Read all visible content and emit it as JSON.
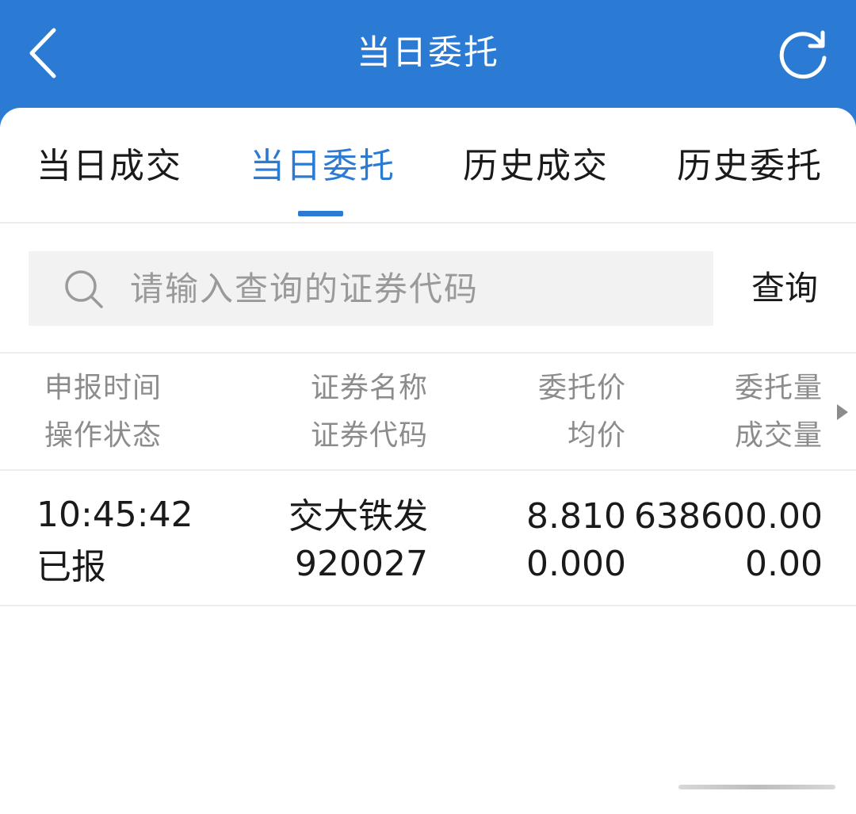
{
  "header": {
    "title": "当日委托",
    "back_icon": "chevron-left-icon",
    "refresh_icon": "refresh-icon"
  },
  "colors": {
    "header_bg": "#2b7ad3",
    "accent": "#2b7ad3",
    "text_primary": "#1a1a1a",
    "text_secondary": "#8c8c8c",
    "search_bg": "#f2f2f2"
  },
  "tabs": [
    {
      "label": "当日成交",
      "active": false
    },
    {
      "label": "当日委托",
      "active": true
    },
    {
      "label": "历史成交",
      "active": false
    },
    {
      "label": "历史委托",
      "active": false
    }
  ],
  "search": {
    "placeholder": "请输入查询的证券代码",
    "value": "",
    "icon": "search-icon",
    "button_label": "查询"
  },
  "columns": {
    "col1_line1": "申报时间",
    "col1_line2": "操作状态",
    "col2_line1": "证券名称",
    "col2_line2": "证券代码",
    "col3_line1": "委托价",
    "col3_line2": "均价",
    "col4_line1": "委托量",
    "col4_line2": "成交量"
  },
  "rows": [
    {
      "time": "10:45:42",
      "status": "已报",
      "name": "交大铁发",
      "code": "920027",
      "price": "8.810",
      "avg_price": "0.000",
      "order_qty": "638600.00",
      "deal_qty": "0.00"
    }
  ]
}
